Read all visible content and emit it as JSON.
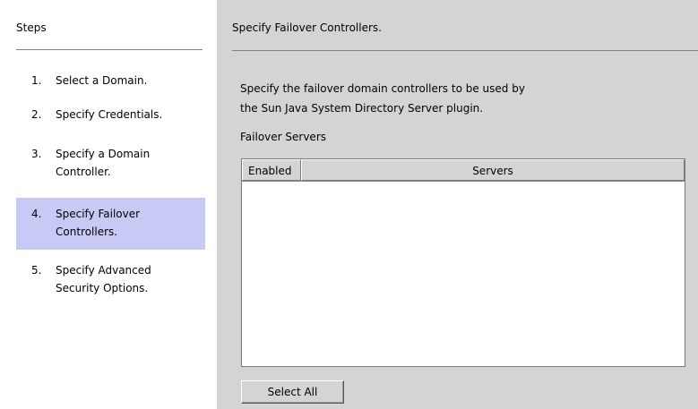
{
  "steps": {
    "title": "Steps",
    "items": [
      {
        "num": "1.",
        "lines": [
          "Select a Domain."
        ]
      },
      {
        "num": "2.",
        "lines": [
          "Specify Credentials."
        ]
      },
      {
        "num": "3.",
        "lines": [
          "Specify a Domain",
          "Controller."
        ]
      },
      {
        "num": "4.",
        "lines": [
          "Specify Failover",
          "Controllers."
        ],
        "active": true
      },
      {
        "num": "5.",
        "lines": [
          "Specify Advanced",
          "Security Options."
        ]
      }
    ]
  },
  "main": {
    "title": "Specify Failover Controllers.",
    "description_lines": [
      "Specify the failover domain controllers to be used by",
      "the Sun Java System Directory Server plugin."
    ],
    "section_label": "Failover Servers",
    "table": {
      "columns": [
        "Enabled",
        "Servers"
      ],
      "rows": []
    },
    "select_all_label": "Select All"
  },
  "colors": {
    "active_step_bg": "#c9c9f5",
    "panel_bg": "#d4d4d4",
    "rule": "#7b8193"
  }
}
